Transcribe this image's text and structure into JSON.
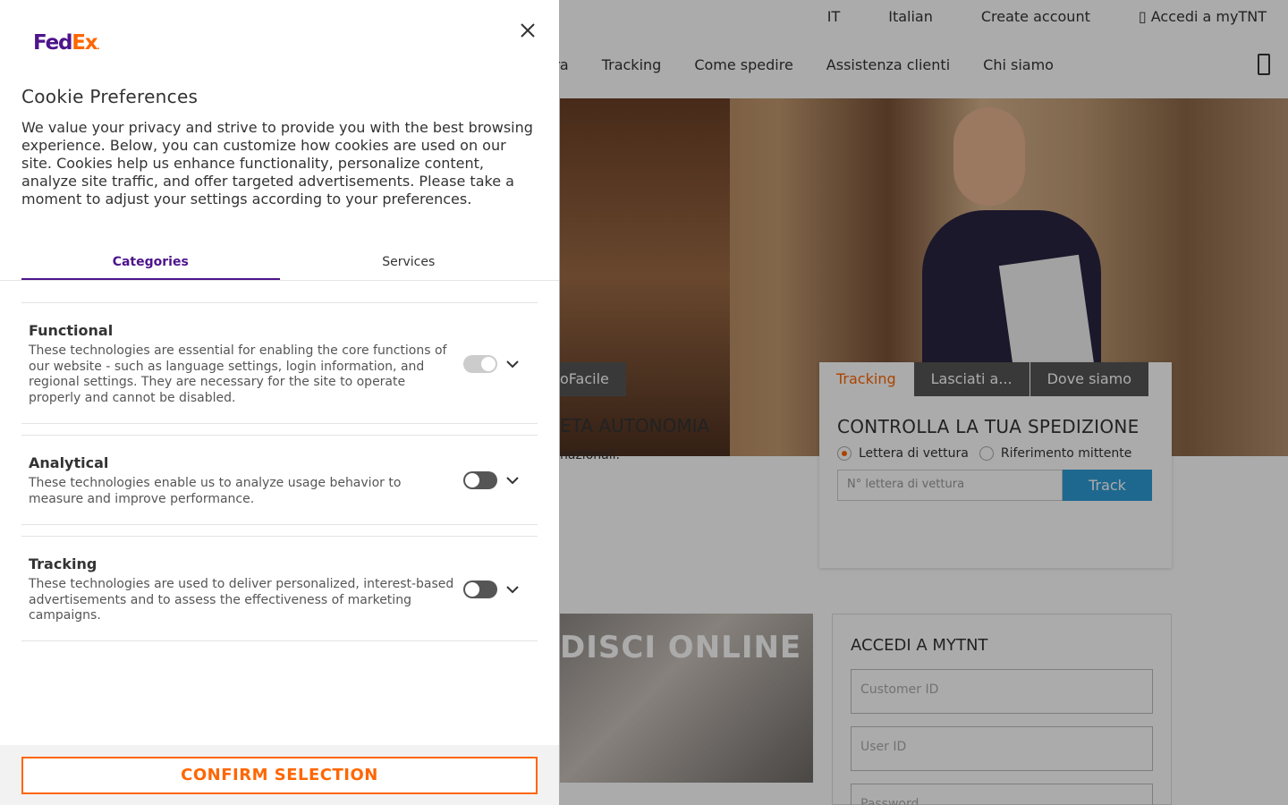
{
  "site": {
    "utility": {
      "lang_code": "IT",
      "language": "Italian",
      "create_account": "Create account",
      "login": "Accedi a myTNT"
    },
    "nav": {
      "item_partial": "i ora",
      "tracking": "Tracking",
      "how_to_ship": "Come spedire",
      "support": "Assistenza clienti",
      "about": "Chi siamo"
    },
    "left_tab": "oFacile",
    "promo": {
      "title": "ETA AUTONOMIA",
      "subtitle": "nazionali."
    },
    "tracking_box": {
      "tabs": [
        "Tracking",
        "Lasciati a...",
        "Dove siamo"
      ],
      "title": "CONTROLLA LA TUA SPEDIZIONE",
      "radio_waybill": "Lettera di vettura",
      "radio_sender_ref": "Riferimento mittente",
      "input_placeholder": "N° lettera di vettura",
      "track_button": "Track"
    },
    "online_banner": "DISCI ONLINE",
    "login_box": {
      "title": "ACCEDI A MYTNT",
      "fields": [
        "Customer ID",
        "User ID",
        "Password"
      ]
    }
  },
  "cookie_panel": {
    "logo": {
      "fed": "Fed",
      "ex": "Ex",
      "dot": "."
    },
    "title": "Cookie Preferences",
    "intro": "We value your privacy and strive to provide you with the best browsing experience. Below, you can customize how cookies are used on our site. Cookies help us enhance functionality, personalize content, analyze site traffic, and offer targeted advertisements. Please take a moment to adjust your settings according to your preferences.",
    "tabs": {
      "categories": "Categories",
      "services": "Services"
    },
    "categories": [
      {
        "name": "Functional",
        "description": "These technologies are essential for enabling the core functions of our website - such as language settings, login information, and regional settings. They are necessary for the site to operate properly and cannot be disabled.",
        "enabled": true,
        "locked": true
      },
      {
        "name": "Analytical",
        "description": "These technologies enable us to analyze usage behavior to measure and improve performance.",
        "enabled": false,
        "locked": false
      },
      {
        "name": "Tracking",
        "description": "These technologies are used to deliver personalized, interest-based advertisements and to assess the effectiveness of marketing campaigns.",
        "enabled": false,
        "locked": false
      }
    ],
    "confirm_button": "CONFIRM SELECTION"
  },
  "colors": {
    "fedex_purple": "#4d148c",
    "fedex_orange": "#ff6600",
    "track_blue": "#2e9bd6"
  },
  "icons": {
    "close": "close-icon",
    "chevron": "chevron-down-icon",
    "cart": "cart-icon"
  }
}
